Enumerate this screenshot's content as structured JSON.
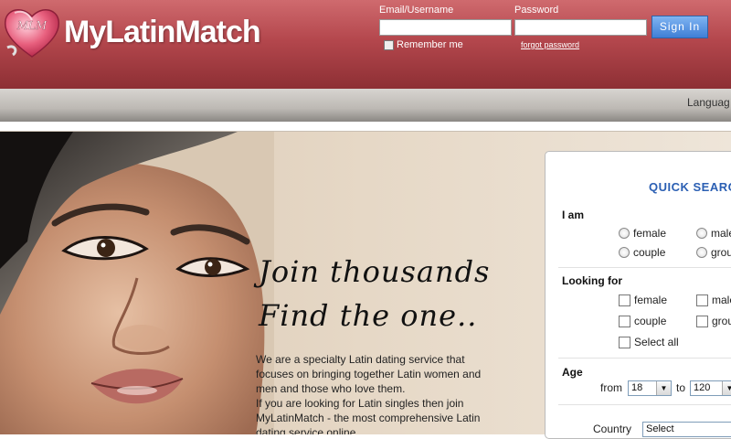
{
  "header": {
    "logo_badge": "MLM",
    "logo_text": "MyLatinMatch",
    "email_label": "Email/Username",
    "password_label": "Password",
    "signin_label": "Sign In",
    "remember_label": "Remember me",
    "forgot_label": "forgot password"
  },
  "nav": {
    "language_label": "Languag"
  },
  "hero": {
    "tagline_1": "Join thousands",
    "tagline_2": "Find the one..",
    "intro_1": "We are a specialty Latin dating service that focuses on bringing together Latin women and men and those who love them.",
    "intro_2": "If you are looking for Latin singles then join MyLatinMatch - the most comprehensive Latin dating service online."
  },
  "quick_search": {
    "title": "QUICK SEARCH",
    "i_am": {
      "label": "I am",
      "options": [
        "female",
        "male",
        "couple",
        "group"
      ]
    },
    "looking_for": {
      "label": "Looking for",
      "options": [
        "female",
        "male",
        "couple",
        "group"
      ],
      "select_all": "Select all"
    },
    "age": {
      "label": "Age",
      "from_label": "from",
      "from_value": "18",
      "to_label": "to",
      "to_value": "120"
    },
    "country": {
      "label": "Country",
      "value": "Select"
    }
  },
  "colors": {
    "header_red": "#b4474d",
    "accent_blue": "#2b5fb3"
  }
}
